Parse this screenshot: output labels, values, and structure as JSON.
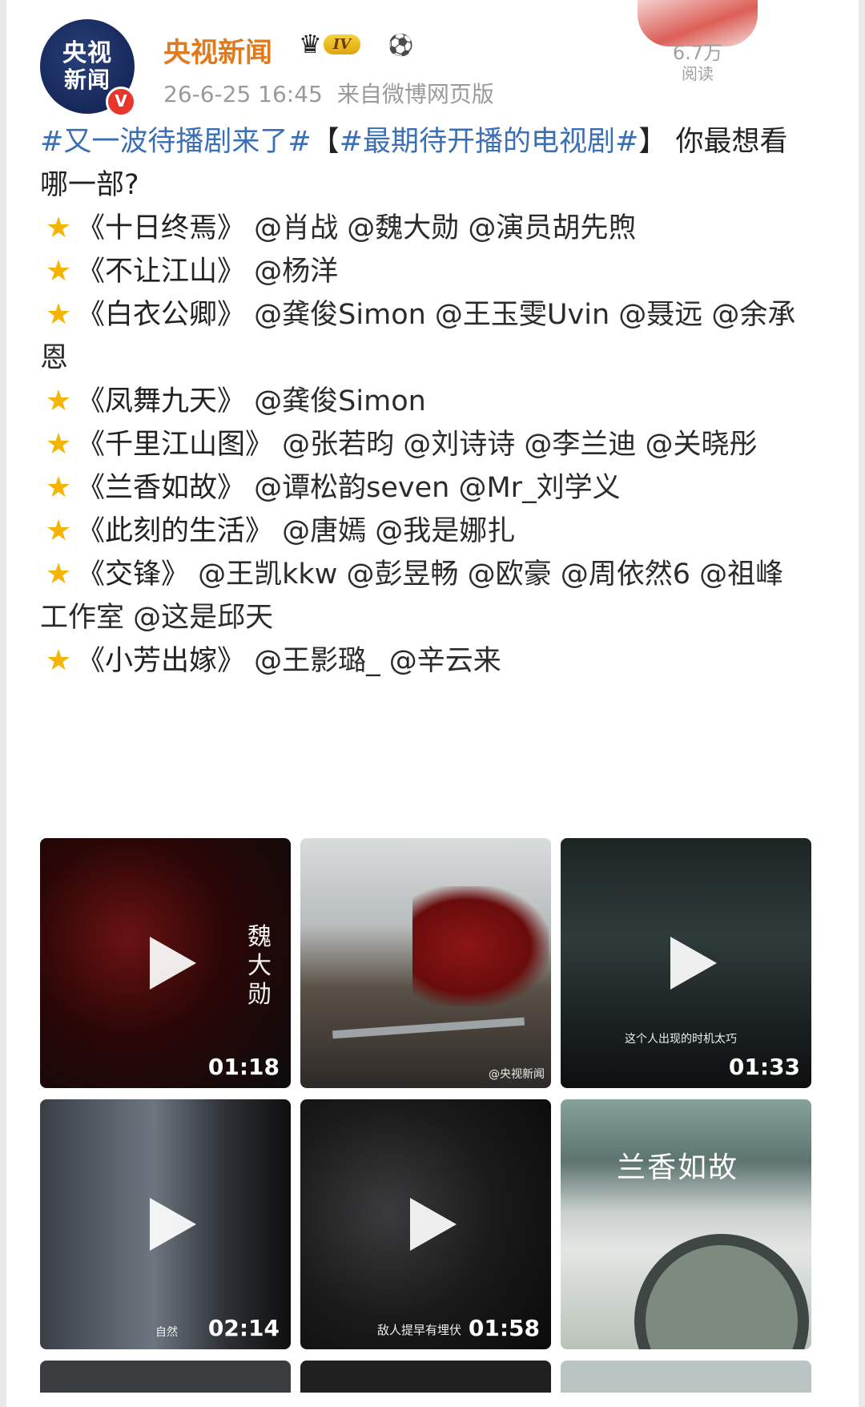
{
  "account": {
    "avatar_line1": "央视",
    "avatar_line2": "新闻",
    "verified_mark": "V",
    "name": "央视新闻",
    "level_badge": "IV",
    "crown_icon": "crown-icon",
    "ball_icon": "football-icon"
  },
  "post_meta": {
    "date": "26-6-25 16:45",
    "source": "来自微博网页版"
  },
  "stats": {
    "read_count": "6.7万",
    "read_label": "阅读"
  },
  "post": {
    "intro_tag1": "#又一波待播剧来了#",
    "intro_bracket_open": "【",
    "intro_tag2": "#最期待开播的电视剧#",
    "intro_bracket_close": "】",
    "intro_rest": "你最想看哪一部?",
    "star_icon": "star-icon",
    "items": [
      {
        "title": "《十日终焉》",
        "mentions": "@肖战 @魏大勋 @演员胡先煦"
      },
      {
        "title": "《不让江山》",
        "mentions": "@杨洋"
      },
      {
        "title": "《白衣公卿》",
        "mentions": "@龚俊Simon @王玉雯Uvin @聂远 @余承恩"
      },
      {
        "title": "《凤舞九天》",
        "mentions": "@龚俊Simon"
      },
      {
        "title": "《千里江山图》",
        "mentions": "@张若昀 @刘诗诗 @李兰迪 @关晓彤"
      },
      {
        "title": "《兰香如故》",
        "mentions": "@谭松韵seven @Mr_刘学义"
      },
      {
        "title": "《此刻的生活》",
        "mentions": "@唐嫣 @我是娜扎"
      },
      {
        "title": "《交锋》",
        "mentions": "@王凯kkw @彭昱畅 @欧豪 @周依然6 @祖峰工作室 @这是邱天"
      },
      {
        "title": "《小芳出嫁》",
        "mentions": "@王影璐_ @辛云来"
      }
    ]
  },
  "media": [
    {
      "kind": "video",
      "duration": "01:18",
      "overlay_text": "魏大勋",
      "caption": ""
    },
    {
      "kind": "image",
      "duration": "",
      "overlay_text": "",
      "caption": "@央视新闻"
    },
    {
      "kind": "video",
      "duration": "01:33",
      "overlay_text": "",
      "caption": "这个人出现的时机太巧"
    },
    {
      "kind": "video",
      "duration": "02:14",
      "overlay_text": "",
      "caption": "自然"
    },
    {
      "kind": "video",
      "duration": "01:58",
      "overlay_text": "",
      "caption": "敌人提早有埋伏"
    },
    {
      "kind": "image",
      "duration": "",
      "overlay_text": "兰香如故",
      "caption": ""
    }
  ],
  "colors": {
    "username": "#e07a1f",
    "link_blue": "#3a6fb4",
    "star": "#f4b400",
    "verified": "#e8362d"
  }
}
